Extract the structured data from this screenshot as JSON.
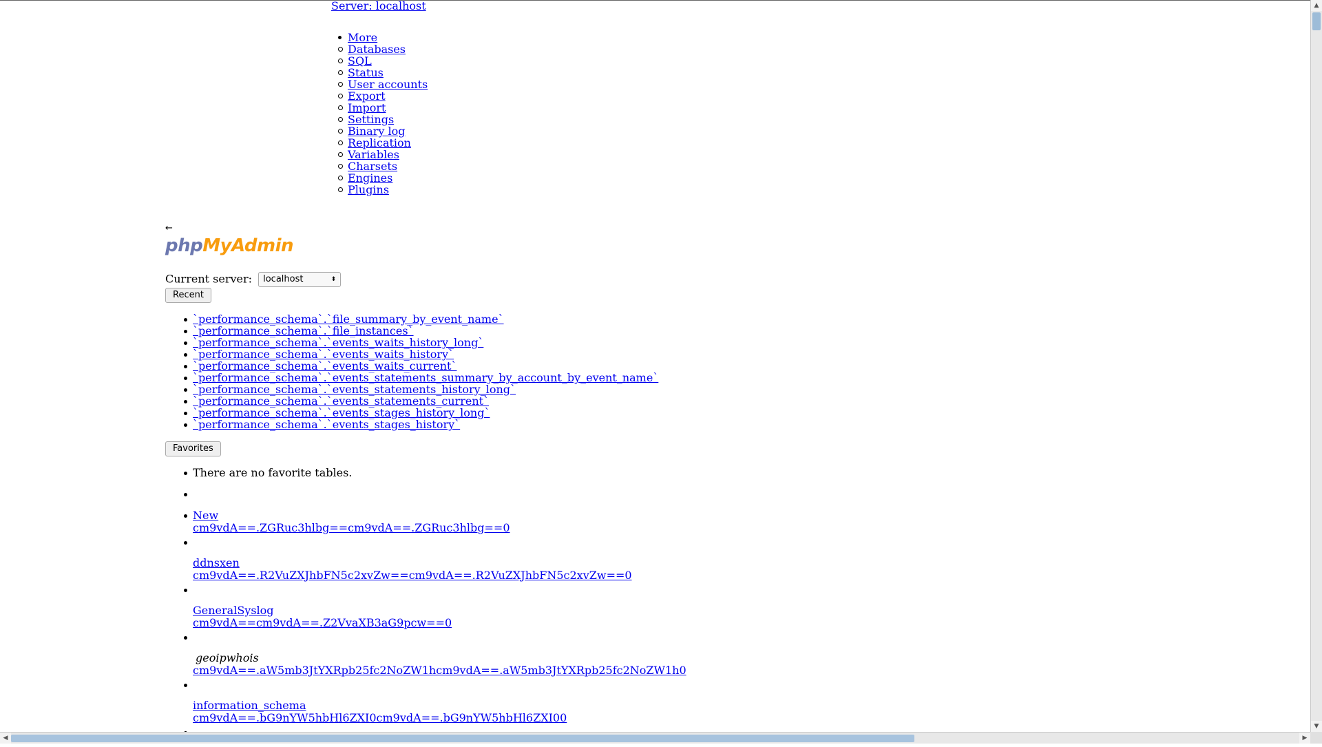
{
  "server_link": "Server: localhost",
  "menu": {
    "more_label": "More",
    "items": [
      " Databases",
      " SQL",
      " Status",
      " User accounts",
      " Export",
      " Import",
      " Settings",
      " Binary log",
      " Replication",
      " Variables",
      " Charsets",
      " Engines",
      " Plugins"
    ]
  },
  "navigation": {
    "back_arrow": "←",
    "logo_php": "php",
    "logo_myadmin": "MyAdmin",
    "current_server_label": "Current server:",
    "current_server_value": "localhost"
  },
  "recent": {
    "button_label": "Recent",
    "items": [
      "`performance_schema`.`file_summary_by_event_name`",
      "`performance_schema`.`file_instances`",
      "`performance_schema`.`events_waits_history_long`",
      "`performance_schema`.`events_waits_history`",
      "`performance_schema`.`events_waits_current`",
      "`performance_schema`.`events_statements_summary_by_account_by_event_name`",
      "`performance_schema`.`events_statements_history_long`",
      "`performance_schema`.`events_statements_current`",
      "`performance_schema`.`events_stages_history_long`",
      "`performance_schema`.`events_stages_history`"
    ]
  },
  "favorites": {
    "button_label": "Favorites",
    "empty_text": "There are no favorite tables."
  },
  "databases": [
    {
      "name": "New",
      "code": "cm9vdA==.ZGRuc3hlbg==cm9vdA==.ZGRuc3hlbg==0",
      "italic": false
    },
    {
      "name": "ddnsxen",
      "code": "cm9vdA==.R2VuZXJhbFN5c2xvZw==cm9vdA==.R2VuZXJhbFN5c2xvZw==0",
      "italic": false
    },
    {
      "name": "GeneralSyslog",
      "code": "cm9vdA==cm9vdA==.Z2VvaXB3aG9pcw==0",
      "italic": false
    },
    {
      "name": "geoipwhois",
      "code": "cm9vdA==.aW5mb3JtYXRpb25fc2NoZW1hcm9vdA==.aW5mb3JtYXRpb25fc2NoZW1h0",
      "italic": true
    },
    {
      "name": "information_schema",
      "code": "cm9vdA==.bG9nYW5hbHl6ZXI0cm9vdA==.bG9nYW5hbHl6ZXI00",
      "italic": false
    }
  ],
  "scrollbars": {
    "up": "▲",
    "down": "▼",
    "left": "◀",
    "right": "▶"
  }
}
